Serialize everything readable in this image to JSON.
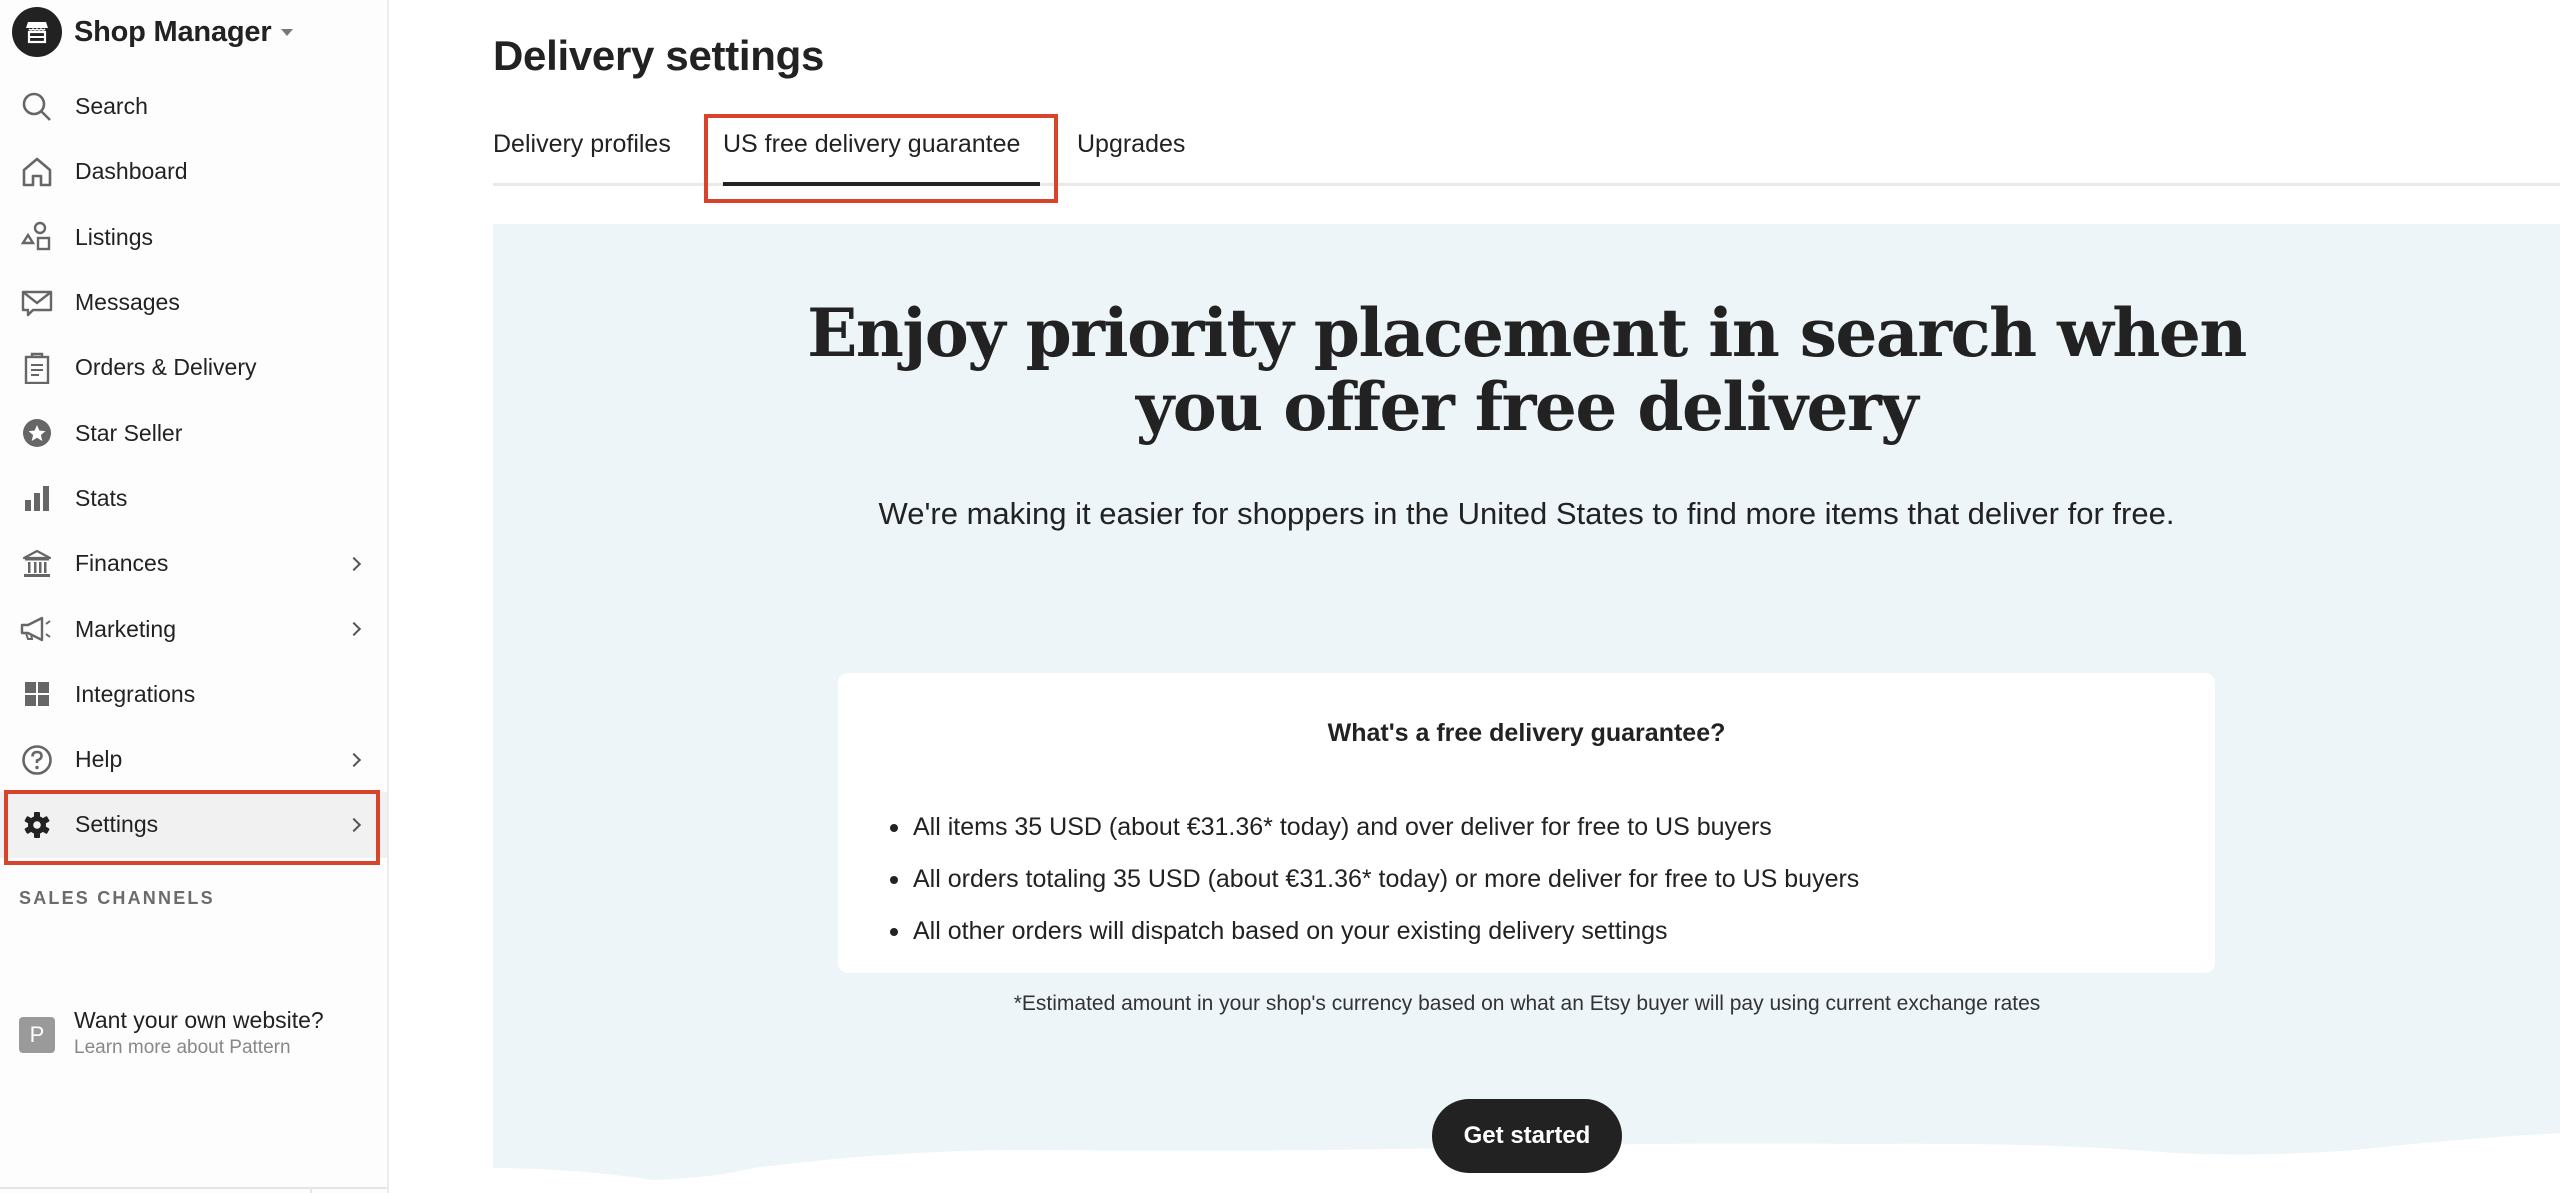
{
  "sidebar": {
    "brand": {
      "title": "Shop Manager",
      "logo_icon": "storefront-icon",
      "caret_icon": "caret-down-icon"
    },
    "items": [
      {
        "label": "Search",
        "icon": "search-icon",
        "has_chevron": false
      },
      {
        "label": "Dashboard",
        "icon": "home-icon",
        "has_chevron": false
      },
      {
        "label": "Listings",
        "icon": "shapes-icon",
        "has_chevron": false
      },
      {
        "label": "Messages",
        "icon": "envelope-icon",
        "has_chevron": false
      },
      {
        "label": "Orders & Delivery",
        "icon": "clipboard-icon",
        "has_chevron": false
      },
      {
        "label": "Star Seller",
        "icon": "star-badge-icon",
        "has_chevron": false
      },
      {
        "label": "Stats",
        "icon": "bar-chart-icon",
        "has_chevron": false
      },
      {
        "label": "Finances",
        "icon": "bank-icon",
        "has_chevron": true
      },
      {
        "label": "Marketing",
        "icon": "megaphone-icon",
        "has_chevron": true
      },
      {
        "label": "Integrations",
        "icon": "grid-icon",
        "has_chevron": false
      },
      {
        "label": "Help",
        "icon": "help-circle-icon",
        "has_chevron": true
      },
      {
        "label": "Settings",
        "icon": "gear-icon",
        "has_chevron": true,
        "active": true
      }
    ],
    "section_label": "SALES CHANNELS",
    "pattern": {
      "badge": "P",
      "title": "Want your own website?",
      "subtitle": "Learn more about Pattern"
    }
  },
  "main": {
    "title": "Delivery settings",
    "tabs": [
      {
        "label": "Delivery profiles",
        "active": false
      },
      {
        "label": "US free delivery guarantee",
        "active": true
      },
      {
        "label": "Upgrades",
        "active": false
      }
    ],
    "promo": {
      "headline": "Enjoy priority placement in search when you offer free delivery",
      "subtext": "We're making it easier for shoppers in the United States to find more items that deliver for free.",
      "card": {
        "title": "What's a free delivery guarantee?",
        "bullets": [
          "All items 35 USD (about €31.36* today) and over deliver for free to US buyers",
          "All orders totaling 35 USD (about €31.36* today) or more deliver for free to US buyers",
          "All other orders will dispatch based on your existing delivery settings"
        ]
      },
      "footnote": "*Estimated amount in your shop's currency based on what an Etsy buyer will pay using current exchange rates",
      "cta_label": "Get started"
    }
  },
  "colors": {
    "highlight": "#d9432b",
    "panel_bg": "#edf5f9",
    "primary_button": "#222222",
    "active_nav_bg": "#f1f1f1"
  }
}
